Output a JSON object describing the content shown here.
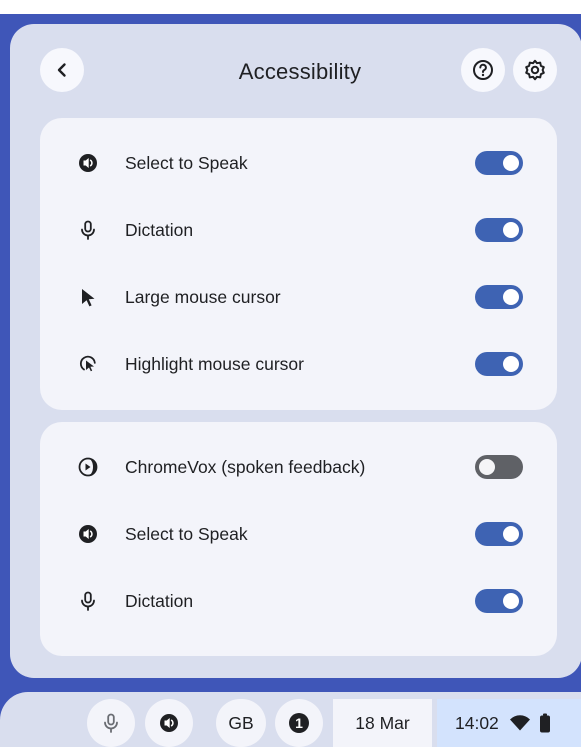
{
  "header": {
    "title": "Accessibility",
    "back_icon": "chevron-left-icon",
    "help_icon": "help-circle-icon",
    "settings_icon": "gear-icon"
  },
  "groups": [
    {
      "items": [
        {
          "label": "Select to Speak",
          "icon": "select-to-speak-icon",
          "enabled": true
        },
        {
          "label": "Dictation",
          "icon": "microphone-icon",
          "enabled": true
        },
        {
          "label": "Large mouse cursor",
          "icon": "mouse-cursor-icon",
          "enabled": true
        },
        {
          "label": "Highlight mouse cursor",
          "icon": "highlight-cursor-icon",
          "enabled": true
        }
      ]
    },
    {
      "items": [
        {
          "label": "ChromeVox (spoken feedback)",
          "icon": "chromevox-icon",
          "enabled": false
        },
        {
          "label": "Select to Speak",
          "icon": "select-to-speak-icon",
          "enabled": true
        },
        {
          "label": "Dictation",
          "icon": "microphone-icon",
          "enabled": true
        }
      ]
    }
  ],
  "shelf": {
    "keyboard_layout": "GB",
    "notification_count": "1",
    "date": "18 Mar",
    "time": "14:02"
  },
  "colors": {
    "toggle_on": "#3e63b3",
    "toggle_off": "#5f6166",
    "panel_bg": "#d9deee",
    "card_bg": "#f3f4fa",
    "status_bg": "#d3e3fd"
  }
}
